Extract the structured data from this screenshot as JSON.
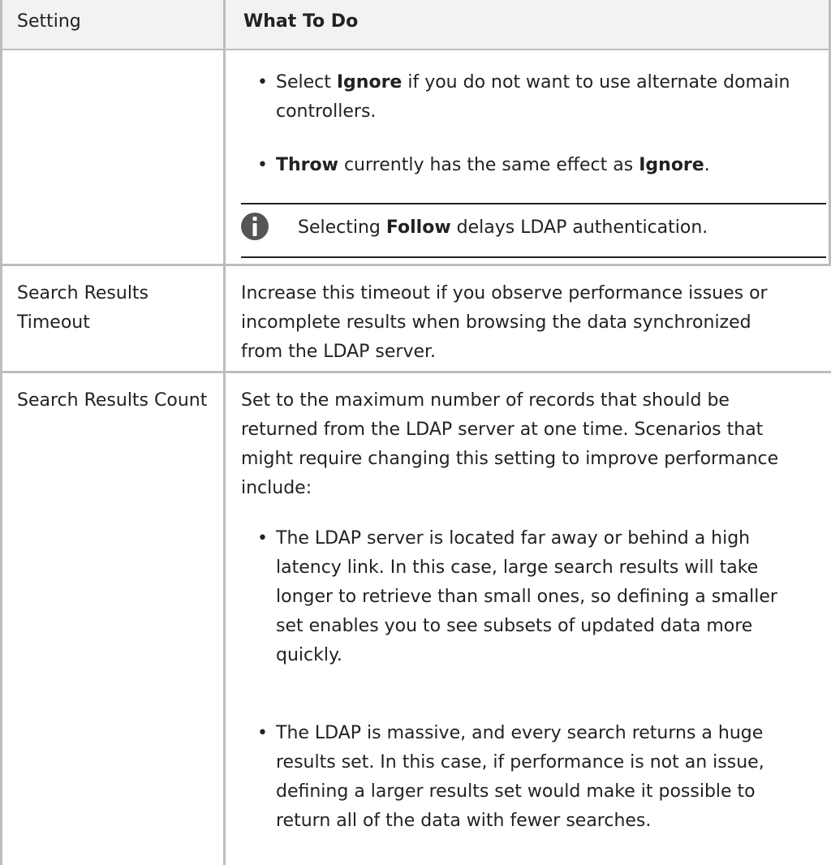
{
  "table": {
    "header": {
      "setting": "Setting",
      "what_to_do": "What To Do"
    },
    "row1": {
      "bullet1": {
        "pre": "Select ",
        "bold": "Ignore",
        "post": " if you do not want to use alternate domain",
        "line2": "controllers."
      },
      "bullet2": {
        "bold1": "Throw",
        "mid": " currently has the same effect as ",
        "bold2": "Ignore",
        "post": "."
      },
      "note": {
        "pre": "Selecting ",
        "bold": "Follow",
        "post": " delays LDAP authentication."
      }
    },
    "row2": {
      "setting_line1": "Search Results",
      "setting_line2": "Timeout",
      "text_lines": [
        "Increase this timeout if you observe performance issues or",
        "incomplete results when browsing the data synchronized",
        "from the LDAP server."
      ]
    },
    "row3": {
      "setting": "Search Results Count",
      "intro_lines": [
        "Set to the maximum number of records that should be",
        "returned from the LDAP server at one time. Scenarios that",
        "might require changing this setting to improve performance",
        "include:"
      ],
      "bullet1_lines": [
        "The LDAP server is located far away or behind a high",
        "latency link. In this case, large search results will take",
        "longer to retrieve than small ones, so defining a smaller",
        "set enables you to see subsets of updated data more",
        "quickly."
      ],
      "bullet2_lines": [
        "The LDAP is massive, and every search returns a huge",
        "results set. In this case, if performance is not an issue,",
        "defining a larger results set would make it possible to",
        "return all of the data with fewer searches."
      ]
    }
  },
  "icons": {
    "note": "info-icon"
  },
  "colors": {
    "header_bg": "#f2f2f2",
    "rule": "#bdbdbd",
    "text": "#222222",
    "icon": "#555555"
  }
}
